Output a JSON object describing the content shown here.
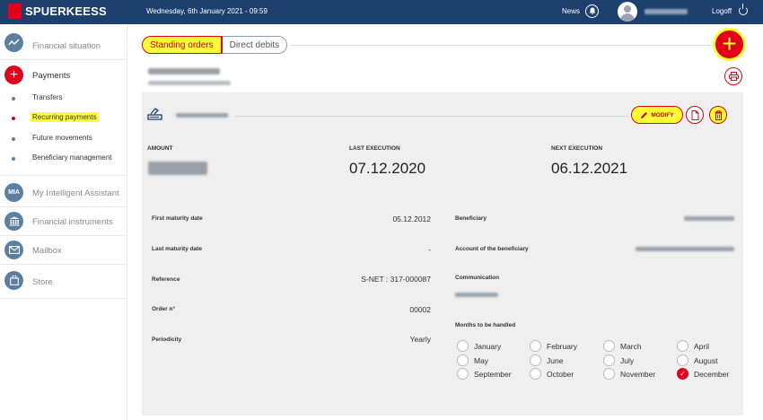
{
  "header": {
    "brand": "SPUERKEESS",
    "date": "Wednesday, 6th January 2021 - 09:59",
    "news_label": "News",
    "logoff_label": "Logoff"
  },
  "sidebar": {
    "items": [
      {
        "label": "Financial situation",
        "icon": "chart-line-icon"
      },
      {
        "label": "Payments",
        "icon": "plus-icon"
      },
      {
        "label": "My Intelligent Assistant",
        "icon_text": "MIA"
      },
      {
        "label": "Financial instruments",
        "icon": "bank-icon"
      },
      {
        "label": "Mailbox",
        "icon": "mail-icon"
      },
      {
        "label": "Store",
        "icon": "bag-icon"
      }
    ],
    "sub_items": [
      {
        "label": "Transfers"
      },
      {
        "label": "Recurring payments"
      },
      {
        "label": "Future movements"
      },
      {
        "label": "Beneficiary management"
      }
    ]
  },
  "tabs": [
    {
      "label": "Standing orders"
    },
    {
      "label": "Direct debits"
    }
  ],
  "order": {
    "modify_label": "MODIFY",
    "amount_label": "AMOUNT",
    "last_exec_label": "LAST EXECUTION",
    "last_exec": "07.12.2020",
    "next_exec_label": "NEXT EXECUTION",
    "next_exec": "06.12.2021"
  },
  "details_left": [
    {
      "label": "First maturity date",
      "value": "05.12.2012"
    },
    {
      "label": "Last maturity date",
      "value": "-"
    },
    {
      "label": "Reference",
      "value": "S-NET : 317-000087"
    },
    {
      "label": "Order n°",
      "value": "00002"
    },
    {
      "label": "Periodicity",
      "value": "Yearly"
    }
  ],
  "details_right": {
    "beneficiary_label": "Beneficiary",
    "account_label": "Account of the beneficiary",
    "communication_label": "Communication",
    "months_label": "Months to be handled"
  },
  "months": [
    {
      "label": "January",
      "checked": false
    },
    {
      "label": "February",
      "checked": false
    },
    {
      "label": "March",
      "checked": false
    },
    {
      "label": "April",
      "checked": false
    },
    {
      "label": "May",
      "checked": false
    },
    {
      "label": "June",
      "checked": false
    },
    {
      "label": "July",
      "checked": false
    },
    {
      "label": "August",
      "checked": false
    },
    {
      "label": "September",
      "checked": false
    },
    {
      "label": "October",
      "checked": false
    },
    {
      "label": "November",
      "checked": false
    },
    {
      "label": "December",
      "checked": true
    }
  ],
  "colors": {
    "navy": "#1c3f6e",
    "red": "#e2001a",
    "highlight": "#ffff33"
  }
}
